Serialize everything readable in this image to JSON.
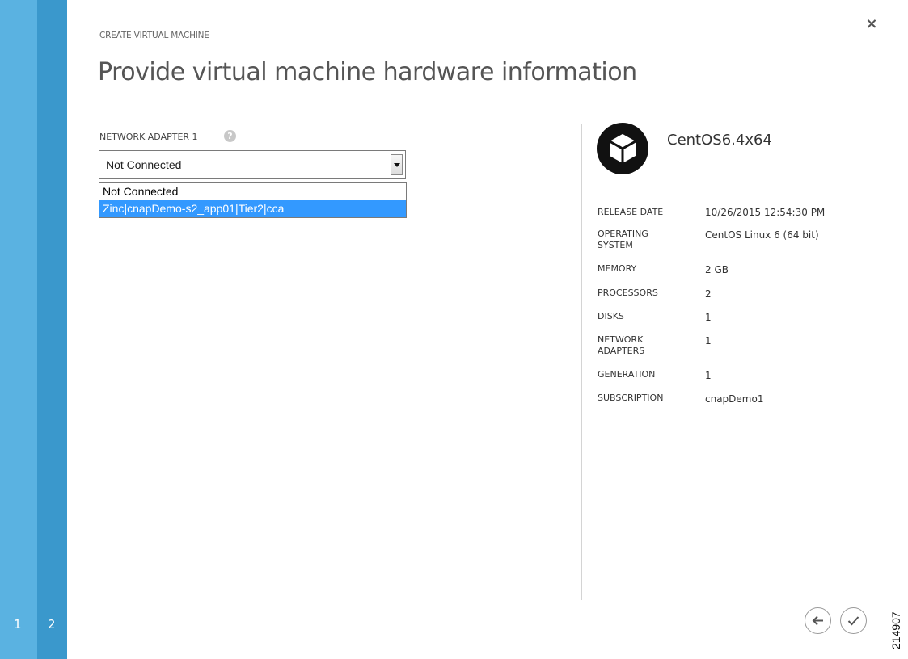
{
  "wizard": {
    "caption": "CREATE VIRTUAL MACHINE",
    "title": "Provide virtual machine hardware information",
    "steps": [
      "1",
      "2"
    ],
    "current_step": "2"
  },
  "network": {
    "label": "NETWORK ADAPTER 1",
    "help_icon": "question-circle-icon",
    "selected": "Not Connected",
    "options": [
      "Not Connected",
      "Zinc|cnapDemo-s2_app01|Tier2|cca"
    ],
    "highlighted_option": "Zinc|cnapDemo-s2_app01|Tier2|cca"
  },
  "vm": {
    "icon": "cube-icon",
    "name": "CentOS6.4x64",
    "specs": [
      {
        "label": "RELEASE DATE",
        "value": "10/26/2015 12:54:30 PM"
      },
      {
        "label": "OPERATING SYSTEM",
        "value": "CentOS Linux 6 (64 bit)"
      },
      {
        "label": "MEMORY",
        "value": "2 GB"
      },
      {
        "label": "PROCESSORS",
        "value": "2"
      },
      {
        "label": "DISKS",
        "value": "1"
      },
      {
        "label": "NETWORK ADAPTERS",
        "value": "1"
      },
      {
        "label": "GENERATION",
        "value": "1"
      },
      {
        "label": "SUBSCRIPTION",
        "value": "cnapDemo1"
      }
    ]
  },
  "buttons": {
    "close_icon": "close-icon",
    "close_glyph": "×",
    "back_icon": "arrow-left-icon",
    "finish_icon": "checkmark-icon"
  },
  "figure_id": "214907",
  "colors": {
    "step1": "#5ab2e1",
    "step2": "#3a98cc",
    "highlight": "#3399ff"
  }
}
